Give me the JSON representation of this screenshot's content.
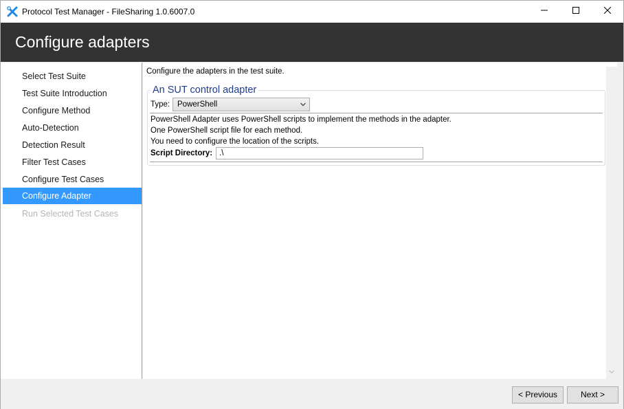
{
  "window": {
    "title": "Protocol Test Manager - FileSharing 1.0.6007.0",
    "icon": "tools-icon"
  },
  "header": {
    "title": "Configure adapters"
  },
  "sidebar": {
    "items": [
      {
        "label": "Select Test Suite",
        "state": "normal"
      },
      {
        "label": "Test Suite Introduction",
        "state": "normal"
      },
      {
        "label": "Configure Method",
        "state": "normal"
      },
      {
        "label": "Auto-Detection",
        "state": "normal"
      },
      {
        "label": "Detection Result",
        "state": "normal"
      },
      {
        "label": "Filter Test Cases",
        "state": "normal"
      },
      {
        "label": "Configure Test Cases",
        "state": "normal"
      },
      {
        "label": "Configure Adapter",
        "state": "active"
      },
      {
        "label": "Run Selected Test Cases",
        "state": "disabled"
      }
    ]
  },
  "main": {
    "intro": "Configure the adapters in the test suite.",
    "adapter_group": {
      "legend": "An SUT control adapter",
      "type_label": "Type:",
      "type_value": "PowerShell",
      "description_lines": [
        "PowerShell Adapter uses PowerShell scripts to implement the methods in the adapter.",
        "One PowerShell script file for each method.",
        "You need to configure the location of the scripts."
      ],
      "script_dir_label": "Script Directory:",
      "script_dir_value": ".\\"
    }
  },
  "footer": {
    "previous_label": "< Previous",
    "next_label": "Next >"
  },
  "colors": {
    "header_bg": "#333333",
    "active_item_bg": "#3399ff",
    "legend_text": "#1e3b8f"
  }
}
